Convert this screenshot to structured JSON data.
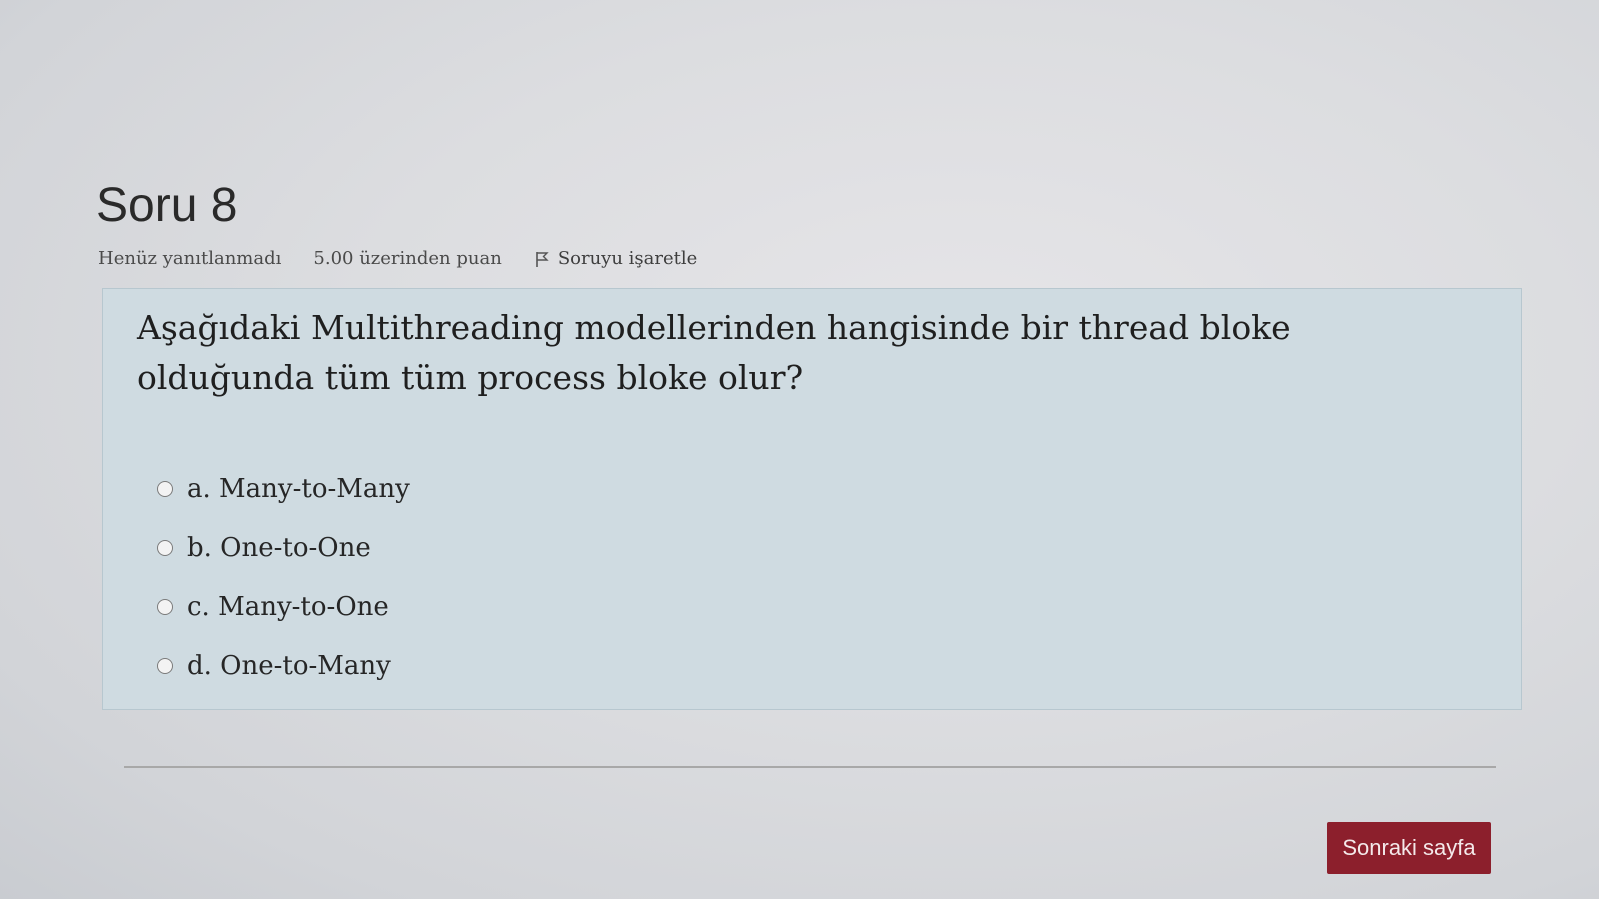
{
  "question": {
    "title": "Soru 8",
    "state": "Henüz yanıtlanmadı",
    "grade": "5.00 üzerinden puan",
    "flag_label": "Soruyu işaretle",
    "text": "Aşağıdaki Multithreading modellerinden hangisinde bir thread bloke olduğunda tüm tüm process bloke olur?",
    "answers": [
      {
        "label": "a. Many-to-Many",
        "selected": false
      },
      {
        "label": "b. One-to-One",
        "selected": false
      },
      {
        "label": "c. Many-to-One",
        "selected": false
      },
      {
        "label": "d. One-to-Many",
        "selected": false
      }
    ]
  },
  "navigation": {
    "next_label": "Sonraki sayfa",
    "next_color": "#8c1f2c"
  },
  "icons": {
    "flag": "flag-icon",
    "radio": "radio-circle"
  }
}
